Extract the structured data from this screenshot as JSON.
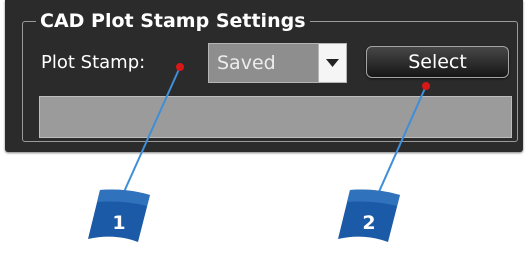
{
  "group": {
    "title": "CAD Plot Stamp Settings"
  },
  "plot_stamp": {
    "label": "Plot Stamp:",
    "selected_value": "Saved",
    "select_button_label": "Select"
  },
  "callouts": [
    {
      "number": "1"
    },
    {
      "number": "2"
    }
  ],
  "colors": {
    "panel_background": "#2b2b2b",
    "callout_flag": "#1b5aa6",
    "callout_line": "#3f8fd8",
    "callout_dot": "#d81818"
  },
  "icons": {
    "dropdown": "chevron-down-icon",
    "callout": "flag-icon"
  }
}
